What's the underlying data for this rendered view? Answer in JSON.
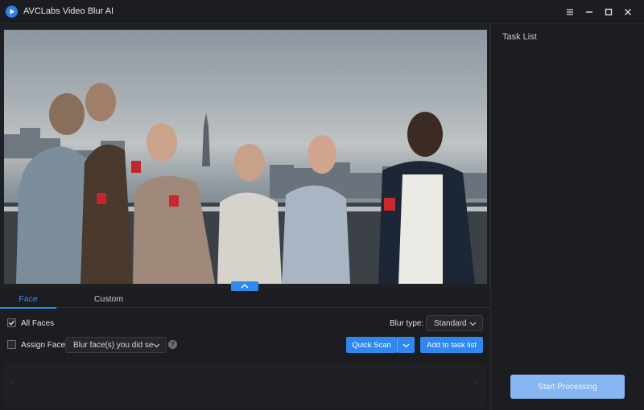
{
  "window": {
    "title": "AVCLabs Video Blur AI",
    "controls": {
      "menu": "☰",
      "minimize": "–",
      "maximize": "☐",
      "close": "✕"
    }
  },
  "colors": {
    "accent": "#2f87f0",
    "background": "#1c1d20",
    "start_button": "#86b7f3"
  },
  "tabs": {
    "face": "Face",
    "custom": "Custom",
    "active": "Face"
  },
  "options": {
    "all_faces_label": "All Faces",
    "all_faces_checked": true,
    "assign_face_label": "Assign Face",
    "assign_face_checked": false,
    "assign_face_dropdown": "Blur face(s) you did se",
    "help": "?"
  },
  "blur": {
    "label": "Blur type:",
    "value": "Standard"
  },
  "buttons": {
    "quick_scan": "Quick Scan",
    "add_to_task": "Add to task list",
    "start_processing": "Start Processing"
  },
  "task_list": {
    "title": "Task List"
  },
  "thumbnails": {
    "prev": "‹",
    "next": "›"
  }
}
